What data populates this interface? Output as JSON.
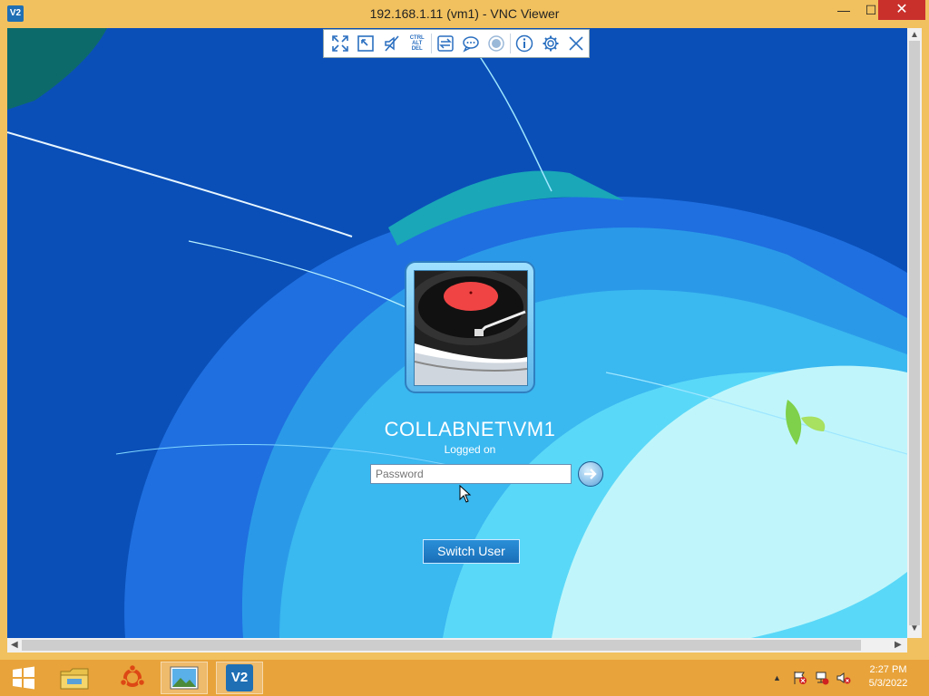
{
  "window": {
    "title": "192.168.1.11 (vm1) - VNC Viewer",
    "app_icon_text": "V2",
    "controls": {
      "minimize": "—",
      "maximize": "☐",
      "close": "✕"
    }
  },
  "vnc_toolbar": {
    "buttons": [
      {
        "name": "full-screen-icon"
      },
      {
        "name": "scale-icon"
      },
      {
        "name": "mute-icon"
      },
      {
        "name": "ctrl-alt-del",
        "lines": [
          "CTRL",
          "ALT",
          "DEL"
        ]
      },
      {
        "name": "transfer-files-icon"
      },
      {
        "name": "chat-icon"
      },
      {
        "name": "record-icon"
      },
      {
        "name": "info-icon"
      },
      {
        "name": "settings-icon"
      },
      {
        "name": "close-connection-icon"
      }
    ]
  },
  "login": {
    "user": "COLLABNET\\VM1",
    "status": "Logged on",
    "password_placeholder": "Password",
    "switch_user": "Switch User"
  },
  "taskbar": {
    "items": [
      {
        "name": "start-button"
      },
      {
        "name": "file-explorer-icon"
      },
      {
        "name": "ubuntu-icon"
      },
      {
        "name": "photos-icon"
      },
      {
        "name": "vnc-viewer-taskbar-icon",
        "active": true
      }
    ],
    "tray": {
      "up_arrow": "▲"
    },
    "clock": {
      "time": "2:27 PM",
      "date": "5/3/2022"
    }
  },
  "colors": {
    "accent": "#f1c15f",
    "taskbar": "#e8a33a",
    "wallpaper_dark": "#0a4fb8",
    "wallpaper_light": "#3ab8f0"
  }
}
